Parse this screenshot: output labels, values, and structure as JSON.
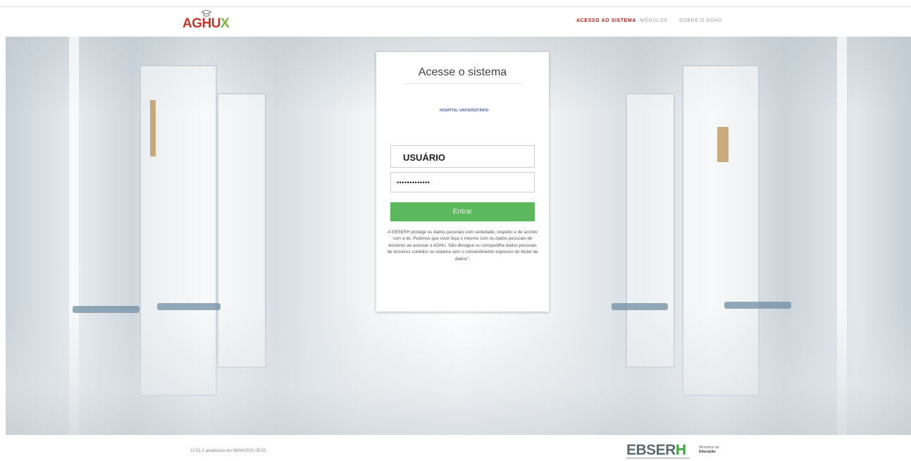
{
  "header": {
    "logo_text_main": "AGHU",
    "logo_text_x": "X",
    "nav": [
      {
        "label": "ACESSO AO SISTEMA",
        "active": true
      },
      {
        "label": "MÓDULOS",
        "active": false
      },
      {
        "label": "SOBRE O AGHU",
        "active": false
      }
    ]
  },
  "login": {
    "title": "Acesse o sistema",
    "hospital_name": "HOSPITAL UNIVERSITÁRIO",
    "username_value": "USUÁRIO",
    "password_mask": "•••••••••••••",
    "submit_label": "Entrar",
    "privacy_notice": "A EBSERH protege os dados pessoais com seriedade, respeito e de acordo com a lei. Pedimos que você faça o mesmo com os dados pessoais de terceiros ao acessar o AGHU. Não divulgue ou compartilhe dados pessoais de terceiros contidos no sistema sem o consentimento expresso do titular de dados\"."
  },
  "footer": {
    "version_text": "10.51.1 atualizada em 08/06/2022 05:53",
    "ebserh_main": "EBSER",
    "ebserh_h": "H",
    "ministry_line1": "Ministério da",
    "ministry_line2": "Educação"
  },
  "colors": {
    "brand_red": "#c0392b",
    "brand_green": "#7cb342",
    "button_green": "#5cb85c",
    "nav_active": "#b71c1c"
  },
  "icons": [
    "graduation-cap-icon"
  ]
}
